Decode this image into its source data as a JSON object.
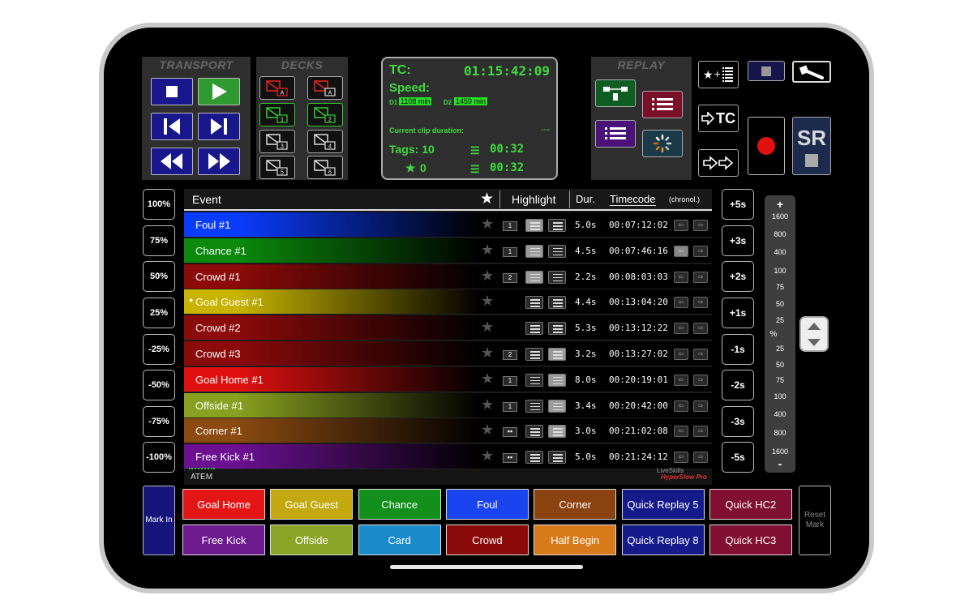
{
  "transport": {
    "title": "TRANSPORT"
  },
  "decks": {
    "title": "DECKS",
    "labels": [
      "A",
      "A",
      "1",
      "2",
      "3",
      "4",
      "5",
      "6"
    ]
  },
  "info": {
    "tc_label": "TC:",
    "tc_value": "01:15:42:09",
    "speed_label": "Speed:",
    "d1_label": "D1",
    "d1_value": "1108 min",
    "d2_label": "D2",
    "d2_value": "1459 min",
    "clip_label": "Current clip duration:",
    "clip_value": "---",
    "tags_label": "Tags: 10",
    "tags_time": "00:32",
    "star_count": "0",
    "star_time": "00:32"
  },
  "replay": {
    "title": "REPLAY",
    "tc_button": "TC",
    "sr_label": "SR"
  },
  "speed_buttons": [
    "100%",
    "75%",
    "50%",
    "25%",
    "-25%",
    "-50%",
    "-75%",
    "-100%"
  ],
  "seconds_buttons": [
    "+5s",
    "+3s",
    "+2s",
    "+1s",
    "-1s",
    "-2s",
    "-3s",
    "-5s"
  ],
  "scale": {
    "plus": "+",
    "minus": "-",
    "percent": "%",
    "top": [
      "1600",
      "800",
      "400",
      "100",
      "75",
      "50",
      "25"
    ],
    "bottom": [
      "25",
      "50",
      "75",
      "100",
      "400",
      "800",
      "1600"
    ]
  },
  "table": {
    "headers": {
      "event": "Event",
      "highlight": "Highlight",
      "dur": "Dur.",
      "timecode": "Timecode",
      "chronol": "(chronol.)"
    },
    "rows": [
      {
        "name": "Foul #1",
        "num": "1",
        "dur": "5.0s",
        "tc": "00:07:12:02",
        "color": "#0a3cff",
        "hl": [
          true,
          false
        ],
        "marked": false,
        "numstyle": "num"
      },
      {
        "name": "Chance #1",
        "num": "1",
        "dur": "4.5s",
        "tc": "00:07:46:16",
        "color": "#0b8a0b",
        "hl": [
          true,
          false
        ],
        "marked": false,
        "numstyle": "num"
      },
      {
        "name": "Crowd #1",
        "num": "2",
        "dur": "2.2s",
        "tc": "00:08:03:03",
        "color": "#8c0a0a",
        "hl": [
          true,
          false
        ],
        "marked": false,
        "numstyle": "num"
      },
      {
        "name": "Goal Guest #1",
        "num": "",
        "dur": "4.4s",
        "tc": "00:13:04:20",
        "color": "#c8b400",
        "hl": [
          false,
          false
        ],
        "marked": true,
        "numstyle": "none"
      },
      {
        "name": "Crowd #2",
        "num": "",
        "dur": "5.3s",
        "tc": "00:13:12:22",
        "color": "#8c0a0a",
        "hl": [
          false,
          false
        ],
        "marked": false,
        "numstyle": "none"
      },
      {
        "name": "Crowd #3",
        "num": "2",
        "dur": "3.2s",
        "tc": "00:13:27:02",
        "color": "#8c0a0a",
        "hl": [
          false,
          true
        ],
        "marked": false,
        "numstyle": "num"
      },
      {
        "name": "Goal Home #1",
        "num": "1",
        "dur": "8.0s",
        "tc": "00:20:19:01",
        "color": "#e01010",
        "hl": [
          false,
          true
        ],
        "marked": false,
        "numstyle": "num"
      },
      {
        "name": "Offside #1",
        "num": "1",
        "dur": "3.4s",
        "tc": "00:20:42:00",
        "color": "#8aa020",
        "hl": [
          false,
          true
        ],
        "marked": false,
        "numstyle": "num"
      },
      {
        "name": "Corner #1",
        "num": "",
        "dur": "3.0s",
        "tc": "00:21:02:08",
        "color": "#8a4a10",
        "hl": [
          false,
          true
        ],
        "marked": false,
        "numstyle": "grid"
      },
      {
        "name": "Free Kick #1",
        "num": "",
        "dur": "5.0s",
        "tc": "00:21:24:12",
        "color": "#6a1090",
        "hl": [
          false,
          false
        ],
        "marked": false,
        "numstyle": "grid"
      }
    ],
    "footer_source": "ATEM",
    "brand_line1": "LiveSkills",
    "brand_line2": "HyperSlow Pro"
  },
  "events": {
    "mark_in": "Mark In",
    "reset_mark": "Reset Mark",
    "buttons": [
      {
        "label": "Goal Home",
        "color": "#e31515"
      },
      {
        "label": "Goal Guest",
        "color": "#c3a90f"
      },
      {
        "label": "Chance",
        "color": "#13901c"
      },
      {
        "label": "Foul",
        "color": "#1a44f0"
      },
      {
        "label": "Corner",
        "color": "#8a4210"
      },
      {
        "label": "Quick Replay 5",
        "color": "#141a8a"
      },
      {
        "label": "Quick HC2",
        "color": "#800f33"
      },
      {
        "label": "Free Kick",
        "color": "#6c1a8e"
      },
      {
        "label": "Offside",
        "color": "#8aa426"
      },
      {
        "label": "Card",
        "color": "#1a8acb"
      },
      {
        "label": "Crowd",
        "color": "#8a0a0a"
      },
      {
        "label": "Half Begin",
        "color": "#d97a1a"
      },
      {
        "label": "Quick Replay 8",
        "color": "#141a8a"
      },
      {
        "label": "Quick HC3",
        "color": "#800f33"
      }
    ]
  }
}
